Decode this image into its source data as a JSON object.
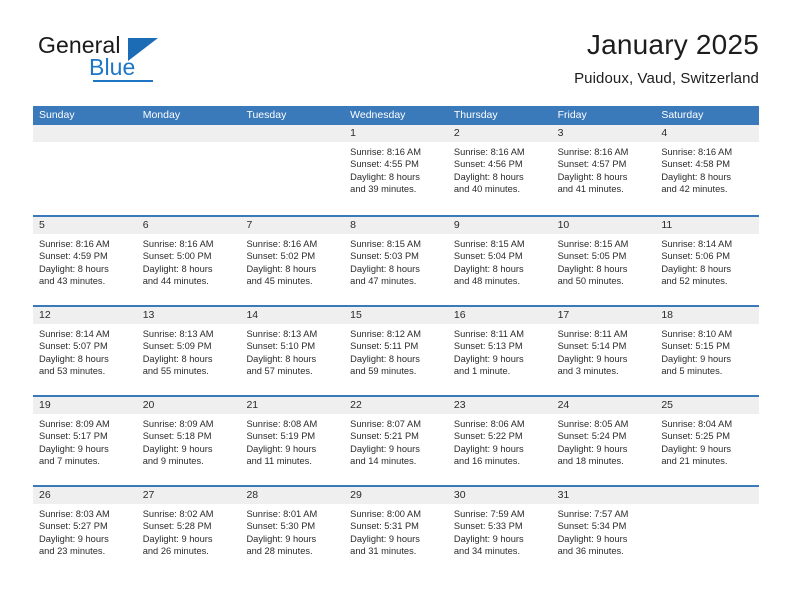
{
  "brand": {
    "word1": "General",
    "word2": "Blue",
    "logo_icon": "triangle-icon",
    "accent_color": "#1f76c4"
  },
  "header": {
    "title": "January 2025",
    "subtitle": "Puidoux, Vaud, Switzerland"
  },
  "theme": {
    "header_blue": "#3a79ba",
    "daynum_band": "#efefef",
    "text": "#2b2b2b"
  },
  "calendar": {
    "weekday_headers": [
      "Sunday",
      "Monday",
      "Tuesday",
      "Wednesday",
      "Thursday",
      "Friday",
      "Saturday"
    ],
    "weeks": [
      [
        {
          "day": "",
          "lines": []
        },
        {
          "day": "",
          "lines": []
        },
        {
          "day": "",
          "lines": []
        },
        {
          "day": "1",
          "lines": [
            "Sunrise: 8:16 AM",
            "Sunset: 4:55 PM",
            "Daylight: 8 hours",
            "and 39 minutes."
          ]
        },
        {
          "day": "2",
          "lines": [
            "Sunrise: 8:16 AM",
            "Sunset: 4:56 PM",
            "Daylight: 8 hours",
            "and 40 minutes."
          ]
        },
        {
          "day": "3",
          "lines": [
            "Sunrise: 8:16 AM",
            "Sunset: 4:57 PM",
            "Daylight: 8 hours",
            "and 41 minutes."
          ]
        },
        {
          "day": "4",
          "lines": [
            "Sunrise: 8:16 AM",
            "Sunset: 4:58 PM",
            "Daylight: 8 hours",
            "and 42 minutes."
          ]
        }
      ],
      [
        {
          "day": "5",
          "lines": [
            "Sunrise: 8:16 AM",
            "Sunset: 4:59 PM",
            "Daylight: 8 hours",
            "and 43 minutes."
          ]
        },
        {
          "day": "6",
          "lines": [
            "Sunrise: 8:16 AM",
            "Sunset: 5:00 PM",
            "Daylight: 8 hours",
            "and 44 minutes."
          ]
        },
        {
          "day": "7",
          "lines": [
            "Sunrise: 8:16 AM",
            "Sunset: 5:02 PM",
            "Daylight: 8 hours",
            "and 45 minutes."
          ]
        },
        {
          "day": "8",
          "lines": [
            "Sunrise: 8:15 AM",
            "Sunset: 5:03 PM",
            "Daylight: 8 hours",
            "and 47 minutes."
          ]
        },
        {
          "day": "9",
          "lines": [
            "Sunrise: 8:15 AM",
            "Sunset: 5:04 PM",
            "Daylight: 8 hours",
            "and 48 minutes."
          ]
        },
        {
          "day": "10",
          "lines": [
            "Sunrise: 8:15 AM",
            "Sunset: 5:05 PM",
            "Daylight: 8 hours",
            "and 50 minutes."
          ]
        },
        {
          "day": "11",
          "lines": [
            "Sunrise: 8:14 AM",
            "Sunset: 5:06 PM",
            "Daylight: 8 hours",
            "and 52 minutes."
          ]
        }
      ],
      [
        {
          "day": "12",
          "lines": [
            "Sunrise: 8:14 AM",
            "Sunset: 5:07 PM",
            "Daylight: 8 hours",
            "and 53 minutes."
          ]
        },
        {
          "day": "13",
          "lines": [
            "Sunrise: 8:13 AM",
            "Sunset: 5:09 PM",
            "Daylight: 8 hours",
            "and 55 minutes."
          ]
        },
        {
          "day": "14",
          "lines": [
            "Sunrise: 8:13 AM",
            "Sunset: 5:10 PM",
            "Daylight: 8 hours",
            "and 57 minutes."
          ]
        },
        {
          "day": "15",
          "lines": [
            "Sunrise: 8:12 AM",
            "Sunset: 5:11 PM",
            "Daylight: 8 hours",
            "and 59 minutes."
          ]
        },
        {
          "day": "16",
          "lines": [
            "Sunrise: 8:11 AM",
            "Sunset: 5:13 PM",
            "Daylight: 9 hours",
            "and 1 minute."
          ]
        },
        {
          "day": "17",
          "lines": [
            "Sunrise: 8:11 AM",
            "Sunset: 5:14 PM",
            "Daylight: 9 hours",
            "and 3 minutes."
          ]
        },
        {
          "day": "18",
          "lines": [
            "Sunrise: 8:10 AM",
            "Sunset: 5:15 PM",
            "Daylight: 9 hours",
            "and 5 minutes."
          ]
        }
      ],
      [
        {
          "day": "19",
          "lines": [
            "Sunrise: 8:09 AM",
            "Sunset: 5:17 PM",
            "Daylight: 9 hours",
            "and 7 minutes."
          ]
        },
        {
          "day": "20",
          "lines": [
            "Sunrise: 8:09 AM",
            "Sunset: 5:18 PM",
            "Daylight: 9 hours",
            "and 9 minutes."
          ]
        },
        {
          "day": "21",
          "lines": [
            "Sunrise: 8:08 AM",
            "Sunset: 5:19 PM",
            "Daylight: 9 hours",
            "and 11 minutes."
          ]
        },
        {
          "day": "22",
          "lines": [
            "Sunrise: 8:07 AM",
            "Sunset: 5:21 PM",
            "Daylight: 9 hours",
            "and 14 minutes."
          ]
        },
        {
          "day": "23",
          "lines": [
            "Sunrise: 8:06 AM",
            "Sunset: 5:22 PM",
            "Daylight: 9 hours",
            "and 16 minutes."
          ]
        },
        {
          "day": "24",
          "lines": [
            "Sunrise: 8:05 AM",
            "Sunset: 5:24 PM",
            "Daylight: 9 hours",
            "and 18 minutes."
          ]
        },
        {
          "day": "25",
          "lines": [
            "Sunrise: 8:04 AM",
            "Sunset: 5:25 PM",
            "Daylight: 9 hours",
            "and 21 minutes."
          ]
        }
      ],
      [
        {
          "day": "26",
          "lines": [
            "Sunrise: 8:03 AM",
            "Sunset: 5:27 PM",
            "Daylight: 9 hours",
            "and 23 minutes."
          ]
        },
        {
          "day": "27",
          "lines": [
            "Sunrise: 8:02 AM",
            "Sunset: 5:28 PM",
            "Daylight: 9 hours",
            "and 26 minutes."
          ]
        },
        {
          "day": "28",
          "lines": [
            "Sunrise: 8:01 AM",
            "Sunset: 5:30 PM",
            "Daylight: 9 hours",
            "and 28 minutes."
          ]
        },
        {
          "day": "29",
          "lines": [
            "Sunrise: 8:00 AM",
            "Sunset: 5:31 PM",
            "Daylight: 9 hours",
            "and 31 minutes."
          ]
        },
        {
          "day": "30",
          "lines": [
            "Sunrise: 7:59 AM",
            "Sunset: 5:33 PM",
            "Daylight: 9 hours",
            "and 34 minutes."
          ]
        },
        {
          "day": "31",
          "lines": [
            "Sunrise: 7:57 AM",
            "Sunset: 5:34 PM",
            "Daylight: 9 hours",
            "and 36 minutes."
          ]
        },
        {
          "day": "",
          "lines": []
        }
      ]
    ]
  }
}
